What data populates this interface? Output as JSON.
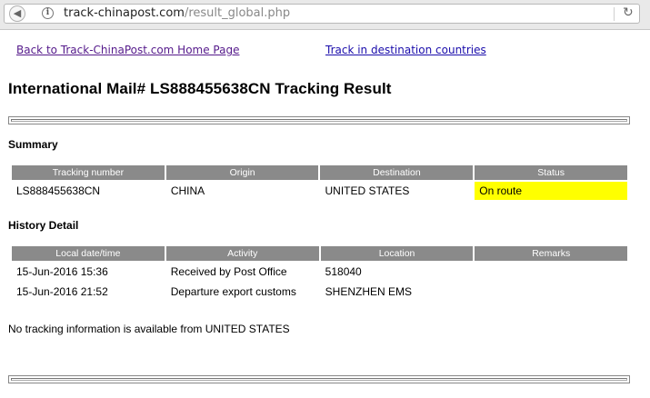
{
  "browser": {
    "url_host": "track-chinapost.com",
    "url_path": "/result_global.php"
  },
  "links": {
    "home": "Back to Track-ChinaPost.com Home Page",
    "destination": "Track in destination countries"
  },
  "page": {
    "title": "International Mail# LS888455638CN Tracking Result"
  },
  "summary": {
    "heading": "Summary",
    "columns": [
      "Tracking number",
      "Origin",
      "Destination",
      "Status"
    ],
    "row": {
      "tracking_number": "LS888455638CN",
      "origin": "CHINA",
      "destination": "UNITED STATES",
      "status": "On route"
    },
    "status_color": "#ffff00"
  },
  "history": {
    "heading": "History Detail",
    "columns": [
      "Local date/time",
      "Activity",
      "Location",
      "Remarks"
    ],
    "rows": [
      {
        "datetime": "15-Jun-2016 15:36",
        "activity": "Received by Post Office",
        "location": "518040",
        "remarks": ""
      },
      {
        "datetime": "15-Jun-2016 21:52",
        "activity": "Departure export customs",
        "location": "SHENZHEN EMS",
        "remarks": ""
      }
    ]
  },
  "note": "No tracking information is available from UNITED STATES"
}
